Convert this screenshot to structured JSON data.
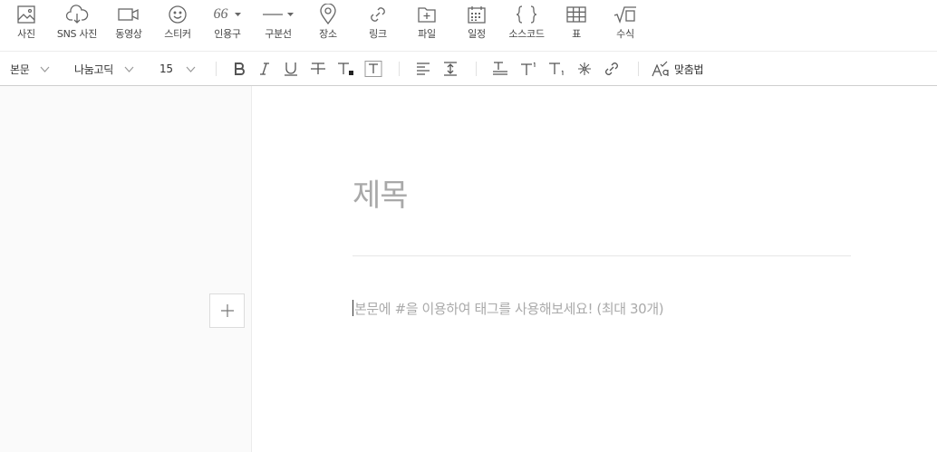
{
  "insert_toolbar": {
    "photo": "사진",
    "sns_photo": "SNS 사진",
    "video": "동영상",
    "sticker": "스티커",
    "quote": "인용구",
    "divider": "구분선",
    "place": "장소",
    "link": "링크",
    "file": "파일",
    "schedule": "일정",
    "source_code": "소스코드",
    "table": "표",
    "formula": "수식",
    "quote_glyph": "66"
  },
  "format_toolbar": {
    "paragraph_style": "본문",
    "font_family": "나눔고딕",
    "font_size": "15",
    "spellcheck": "맞춤법"
  },
  "editor": {
    "title_placeholder": "제목",
    "body_placeholder": "본문에 #을 이용하여 태그를 사용해보세요! (최대 30개)"
  },
  "colors": {
    "icon": "#666666",
    "placeholder": "#a9a9a9",
    "left_panel": "#fafafa"
  }
}
